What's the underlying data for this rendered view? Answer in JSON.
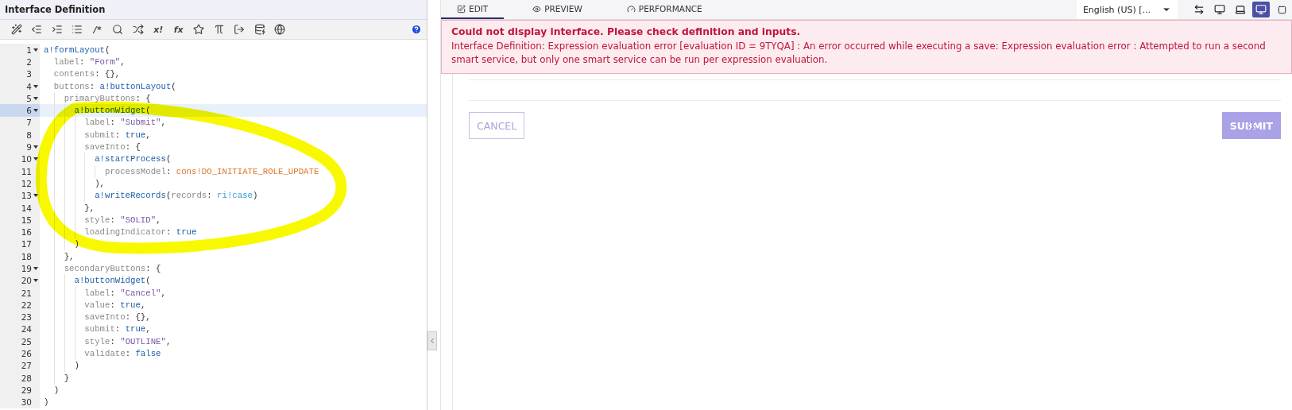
{
  "editor": {
    "title": "Interface Definition",
    "toolbar": [
      {
        "kind": "icon"
      },
      {
        "kind": "icon"
      },
      {
        "kind": "icon"
      },
      {
        "kind": "icon"
      },
      {
        "kind": "glyph",
        "label": "/*"
      },
      {
        "kind": "icon"
      },
      {
        "kind": "icon"
      },
      {
        "kind": "glyph",
        "label": "x!"
      },
      {
        "kind": "glyph",
        "label": "fx"
      },
      {
        "kind": "icon"
      },
      {
        "kind": "icon"
      },
      {
        "kind": "icon"
      },
      {
        "kind": "icon"
      },
      {
        "kind": "icon"
      }
    ],
    "lines": [
      {
        "number": "1",
        "fold": true,
        "active": false,
        "tokens": [
          {
            "kind": "fn",
            "text": "a!formLayout"
          },
          {
            "kind": "punc",
            "text": "("
          }
        ]
      },
      {
        "number": "2",
        "fold": false,
        "active": false,
        "tokens": [
          {
            "kind": "key",
            "text": "  label"
          },
          {
            "kind": "punc",
            "text": ": "
          },
          {
            "kind": "str",
            "text": "\"Form\""
          },
          {
            "kind": "punc",
            "text": ","
          }
        ]
      },
      {
        "number": "3",
        "fold": false,
        "active": false,
        "tokens": [
          {
            "kind": "key",
            "text": "  contents"
          },
          {
            "kind": "punc",
            "text": ": {},"
          }
        ]
      },
      {
        "number": "4",
        "fold": true,
        "active": false,
        "tokens": [
          {
            "kind": "key",
            "text": "  buttons"
          },
          {
            "kind": "punc",
            "text": ": "
          },
          {
            "kind": "fn",
            "text": "a!buttonLayout"
          },
          {
            "kind": "punc",
            "text": "("
          }
        ]
      },
      {
        "number": "5",
        "fold": true,
        "active": false,
        "tokens": [
          {
            "kind": "key",
            "text": "    primaryButtons"
          },
          {
            "kind": "punc",
            "text": ": {"
          }
        ]
      },
      {
        "number": "6",
        "fold": true,
        "active": true,
        "tokens": [
          {
            "kind": "fn",
            "text": "      a!buttonWidget"
          },
          {
            "kind": "punc",
            "text": "("
          }
        ]
      },
      {
        "number": "7",
        "fold": false,
        "active": false,
        "tokens": [
          {
            "kind": "key",
            "text": "        label"
          },
          {
            "kind": "punc",
            "text": ": "
          },
          {
            "kind": "str",
            "text": "\"Submit\""
          },
          {
            "kind": "punc",
            "text": ","
          }
        ]
      },
      {
        "number": "8",
        "fold": false,
        "active": false,
        "tokens": [
          {
            "kind": "key",
            "text": "        submit"
          },
          {
            "kind": "punc",
            "text": ": "
          },
          {
            "kind": "bool",
            "text": "true"
          },
          {
            "kind": "punc",
            "text": ","
          }
        ]
      },
      {
        "number": "9",
        "fold": true,
        "active": false,
        "tokens": [
          {
            "kind": "key",
            "text": "        saveInto"
          },
          {
            "kind": "punc",
            "text": ": {"
          }
        ]
      },
      {
        "number": "10",
        "fold": true,
        "active": false,
        "tokens": [
          {
            "kind": "fn",
            "text": "          a!startProcess"
          },
          {
            "kind": "punc",
            "text": "("
          }
        ]
      },
      {
        "number": "11",
        "fold": false,
        "active": false,
        "tokens": [
          {
            "kind": "key",
            "text": "            processModel"
          },
          {
            "kind": "punc",
            "text": ": "
          },
          {
            "kind": "const",
            "text": "cons!DO_INITIATE_ROLE_UPDATE"
          }
        ]
      },
      {
        "number": "12",
        "fold": false,
        "active": false,
        "tokens": [
          {
            "kind": "punc",
            "text": "          ),"
          }
        ]
      },
      {
        "number": "13",
        "fold": true,
        "active": false,
        "tokens": [
          {
            "kind": "fn",
            "text": "          a!writeRecords"
          },
          {
            "kind": "punc",
            "text": "("
          },
          {
            "kind": "key",
            "text": "records"
          },
          {
            "kind": "punc",
            "text": ": "
          },
          {
            "kind": "ref",
            "text": "ri!case"
          },
          {
            "kind": "punc",
            "text": ")"
          }
        ]
      },
      {
        "number": "14",
        "fold": false,
        "active": false,
        "tokens": [
          {
            "kind": "punc",
            "text": "        },"
          }
        ]
      },
      {
        "number": "15",
        "fold": false,
        "active": false,
        "tokens": [
          {
            "kind": "key",
            "text": "        style"
          },
          {
            "kind": "punc",
            "text": ": "
          },
          {
            "kind": "str",
            "text": "\"SOLID\""
          },
          {
            "kind": "punc",
            "text": ","
          }
        ]
      },
      {
        "number": "16",
        "fold": false,
        "active": false,
        "tokens": [
          {
            "kind": "key",
            "text": "        loadingIndicator"
          },
          {
            "kind": "punc",
            "text": ": "
          },
          {
            "kind": "bool",
            "text": "true"
          }
        ]
      },
      {
        "number": "17",
        "fold": false,
        "active": false,
        "tokens": [
          {
            "kind": "punc",
            "text": "      )"
          }
        ]
      },
      {
        "number": "18",
        "fold": false,
        "active": false,
        "tokens": [
          {
            "kind": "punc",
            "text": "    },"
          }
        ]
      },
      {
        "number": "19",
        "fold": true,
        "active": false,
        "tokens": [
          {
            "kind": "key",
            "text": "    secondaryButtons"
          },
          {
            "kind": "punc",
            "text": ": {"
          }
        ]
      },
      {
        "number": "20",
        "fold": true,
        "active": false,
        "tokens": [
          {
            "kind": "fn",
            "text": "      a!buttonWidget"
          },
          {
            "kind": "punc",
            "text": "("
          }
        ]
      },
      {
        "number": "21",
        "fold": false,
        "active": false,
        "tokens": [
          {
            "kind": "key",
            "text": "        label"
          },
          {
            "kind": "punc",
            "text": ": "
          },
          {
            "kind": "str",
            "text": "\"Cancel\""
          },
          {
            "kind": "punc",
            "text": ","
          }
        ]
      },
      {
        "number": "22",
        "fold": false,
        "active": false,
        "tokens": [
          {
            "kind": "key",
            "text": "        value"
          },
          {
            "kind": "punc",
            "text": ": "
          },
          {
            "kind": "bool",
            "text": "true"
          },
          {
            "kind": "punc",
            "text": ","
          }
        ]
      },
      {
        "number": "23",
        "fold": false,
        "active": false,
        "tokens": [
          {
            "kind": "key",
            "text": "        saveInto"
          },
          {
            "kind": "punc",
            "text": ": {},"
          }
        ]
      },
      {
        "number": "24",
        "fold": false,
        "active": false,
        "tokens": [
          {
            "kind": "key",
            "text": "        submit"
          },
          {
            "kind": "punc",
            "text": ": "
          },
          {
            "kind": "bool",
            "text": "true"
          },
          {
            "kind": "punc",
            "text": ","
          }
        ]
      },
      {
        "number": "25",
        "fold": false,
        "active": false,
        "tokens": [
          {
            "kind": "key",
            "text": "        style"
          },
          {
            "kind": "punc",
            "text": ": "
          },
          {
            "kind": "str",
            "text": "\"OUTLINE\""
          },
          {
            "kind": "punc",
            "text": ","
          }
        ]
      },
      {
        "number": "26",
        "fold": false,
        "active": false,
        "tokens": [
          {
            "kind": "key",
            "text": "        validate"
          },
          {
            "kind": "punc",
            "text": ": "
          },
          {
            "kind": "bool",
            "text": "false"
          }
        ]
      },
      {
        "number": "27",
        "fold": false,
        "active": false,
        "tokens": [
          {
            "kind": "punc",
            "text": "      )"
          }
        ]
      },
      {
        "number": "28",
        "fold": false,
        "active": false,
        "tokens": [
          {
            "kind": "punc",
            "text": "    }"
          }
        ]
      },
      {
        "number": "29",
        "fold": false,
        "active": false,
        "tokens": [
          {
            "kind": "punc",
            "text": "  )"
          }
        ]
      },
      {
        "number": "30",
        "fold": false,
        "active": false,
        "tokens": [
          {
            "kind": "punc",
            "text": ")"
          }
        ]
      }
    ]
  },
  "preview": {
    "tabs": [
      {
        "label": "EDIT",
        "selected": true
      },
      {
        "label": "PREVIEW",
        "selected": false
      },
      {
        "label": "PERFORMANCE",
        "selected": false
      }
    ],
    "locale": "English (US) [...",
    "devices": [
      {
        "selected": false
      },
      {
        "selected": false
      },
      {
        "selected": false
      },
      {
        "selected": true
      },
      {
        "selected": false
      }
    ],
    "error": {
      "title": "Could not display interface. Please check definition and inputs.",
      "message": "Interface Definition: Expression evaluation error [evaluation ID = 9TYQA] : An error occurred while executing a save: Expression evaluation error : Attempted to run a second smart service, but only one smart service can be run per expression evaluation."
    },
    "buttons": [
      {
        "label": "CANCEL",
        "kind": "outline"
      },
      {
        "label": "SUBMIT",
        "kind": "solid",
        "loading": true
      }
    ]
  }
}
